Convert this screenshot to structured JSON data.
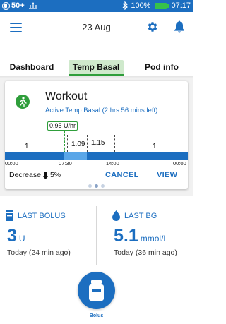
{
  "status_bar": {
    "badge": "50+",
    "battery": "100%",
    "time": "07:17",
    "colors": {
      "bar": "#1c6ec0",
      "battery": "#37c24a"
    }
  },
  "header": {
    "date": "23 Aug",
    "icons": [
      "menu-icon",
      "gear-icon",
      "bell-icon"
    ]
  },
  "tabs": [
    {
      "label": "Dashboard",
      "active": false
    },
    {
      "label": "Temp Basal",
      "active": true
    },
    {
      "label": "Pod info",
      "active": false
    }
  ],
  "temp_basal_card": {
    "title": "Workout",
    "subtitle": "Active Temp Basal (2 hrs 56 mins left)",
    "current_rate": "0.95 U/hr",
    "rate_segments": [
      "1",
      "1.09",
      "1.15",
      "1"
    ],
    "time_ticks": [
      "00:00",
      "07:30",
      "14:00",
      "00:00"
    ],
    "decrease_label": "Decrease",
    "decrease_value": "5%",
    "cancel_label": "CANCEL",
    "view_label": "VIEW"
  },
  "pager": {
    "pages": 3,
    "active_index": 1
  },
  "last_bolus": {
    "label": "LAST BOLUS",
    "value": "3",
    "unit": "U",
    "time": "Today (24 min ago)"
  },
  "last_bg": {
    "label": "LAST BG",
    "value": "5.1",
    "unit": "mmol/L",
    "time": "Today (36 min ago)"
  },
  "bolus_button": {
    "label": "Bolus"
  },
  "colors": {
    "accent": "#1c6ec0",
    "active_tab": "#cfe9cc",
    "green": "#2f9e3b"
  }
}
